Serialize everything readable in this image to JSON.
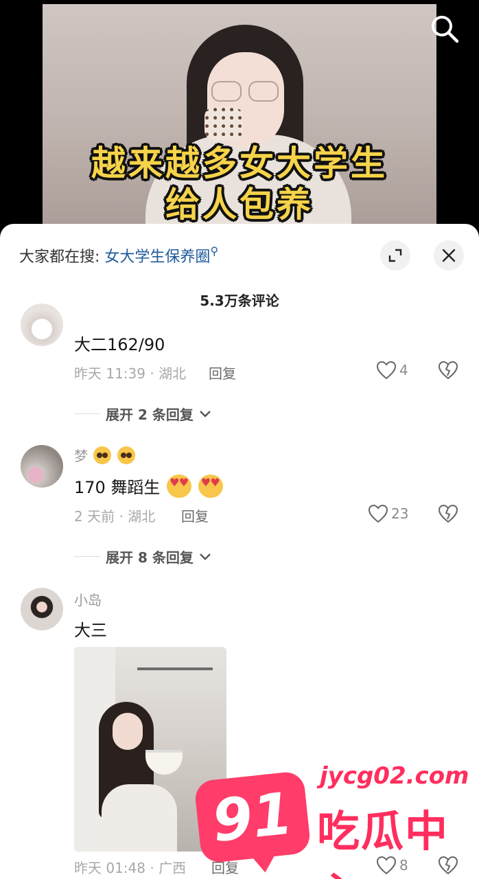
{
  "video": {
    "caption_line1": "越来越多女大学生",
    "caption_line2": "给人包养"
  },
  "search_hint": {
    "prefix": "大家都在搜:",
    "keyword": "女大学生保养圈"
  },
  "comments_count": "5.3万条评论",
  "comments": [
    {
      "username": "",
      "text": "大二162/90",
      "time_location": "昨天 11:39 · 湖北",
      "reply_label": "回复",
      "likes": "4",
      "expand_label": "展开 2 条回复"
    },
    {
      "username": "梦",
      "text": "170 舞蹈生",
      "time_location": "2 天前 · 湖北",
      "reply_label": "回复",
      "likes": "23",
      "expand_label": "展开 8 条回复"
    },
    {
      "username": "小岛",
      "text": "大三",
      "time_location": "昨天 01:48 · 广西",
      "reply_label": "回复",
      "likes": "8"
    }
  ],
  "watermark": {
    "number": "91",
    "url": "jycg02.com",
    "name": "吃瓜中心"
  },
  "colors": {
    "caption": "#f6d34a",
    "keyword_link": "#1e5a9a",
    "watermark": "#ff2e5e"
  },
  "icons": [
    "search-icon",
    "magnifier-icon",
    "expand-icon",
    "close-icon",
    "heart-icon",
    "broken-heart-icon",
    "chevron-down-icon"
  ]
}
